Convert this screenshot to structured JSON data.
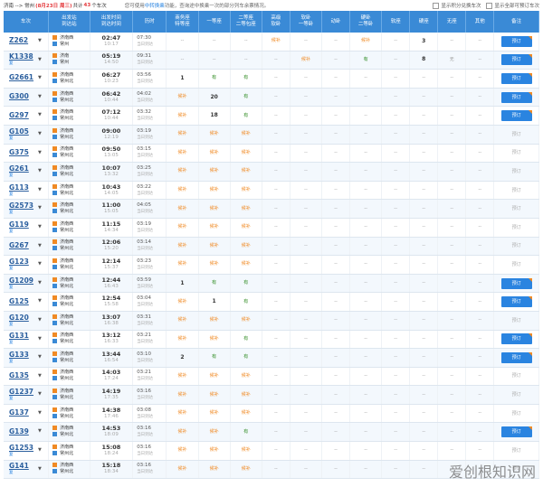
{
  "header": {
    "route": "济南 --> 常州",
    "date": "(8月23日 周三)",
    "count_prefix": "共计",
    "count": "43",
    "count_suffix": "个车次",
    "notice_pre": "您可使用",
    "notice_hl": "中转换乘",
    "notice_post": "功能，查询途中换乘一次的部分列车余票情况。",
    "opt1": "显示积分兑换车次",
    "opt2": "显示全部可预订车次"
  },
  "columns": [
    "车次",
    "出发站\n到达站",
    "出发时间\n到达时间",
    "历时",
    "商务座\n特等座",
    "一等座",
    "二等座\n二等包座",
    "高级\n软卧",
    "软卧\n一等卧",
    "动卧",
    "硬卧\n二等卧",
    "软座",
    "硬座",
    "无座",
    "其他",
    "备注"
  ],
  "rows": [
    {
      "train": "Z262",
      "sub": "",
      "from": "济南西",
      "to": "常州",
      "dep": "02:47",
      "arr": "10:17",
      "dur": "07:30",
      "day": "当日到达",
      "c": [
        "--",
        "--",
        "--",
        "候补",
        "--",
        "--",
        "候补",
        "--",
        "3",
        "--",
        "--"
      ],
      "btn": "预订",
      "bookable": true,
      "from_icon": "s"
    },
    {
      "train": "K1338",
      "sub": "复",
      "from": "济南",
      "to": "常州",
      "dep": "05:19",
      "arr": "14:50",
      "dur": "09:31",
      "day": "当日到达",
      "c": [
        "--",
        "--",
        "--",
        "--",
        "候补",
        "--",
        "有",
        "--",
        "8",
        "无",
        "--"
      ],
      "btn": "预订",
      "bookable": true,
      "from_icon": "s"
    },
    {
      "train": "G2661",
      "sub": "",
      "from": "济南西",
      "to": "常州北",
      "dep": "06:27",
      "arr": "10:23",
      "dur": "03:56",
      "day": "当日到达",
      "c": [
        "1",
        "有",
        "有",
        "--",
        "--",
        "--",
        "--",
        "--",
        "--",
        "--",
        "--"
      ],
      "btn": "预订",
      "bookable": true,
      "from_icon": "s"
    },
    {
      "train": "G300",
      "sub": "",
      "from": "济南西",
      "to": "常州北",
      "dep": "06:42",
      "arr": "10:44",
      "dur": "04:02",
      "day": "当日到达",
      "c": [
        "候补",
        "20",
        "有",
        "--",
        "--",
        "--",
        "--",
        "--",
        "--",
        "--",
        "--"
      ],
      "btn": "预订",
      "bookable": true,
      "from_icon": "s"
    },
    {
      "train": "G297",
      "sub": "",
      "from": "济南西",
      "to": "常州北",
      "dep": "07:12",
      "arr": "10:44",
      "dur": "03:32",
      "day": "当日到达",
      "c": [
        "候补",
        "18",
        "有",
        "--",
        "--",
        "--",
        "--",
        "--",
        "--",
        "--",
        "--"
      ],
      "btn": "预订",
      "bookable": true,
      "from_icon": "s"
    },
    {
      "train": "G105",
      "sub": "复",
      "from": "济南西",
      "to": "常州北",
      "dep": "09:00",
      "arr": "12:19",
      "dur": "03:19",
      "day": "当日到达",
      "c": [
        "候补",
        "候补",
        "候补",
        "--",
        "--",
        "--",
        "--",
        "--",
        "--",
        "--",
        "--"
      ],
      "btn": "预订",
      "bookable": false,
      "from_icon": "s"
    },
    {
      "train": "G375",
      "sub": "",
      "from": "济南西",
      "to": "常州北",
      "dep": "09:50",
      "arr": "13:05",
      "dur": "03:15",
      "day": "当日到达",
      "c": [
        "候补",
        "候补",
        "候补",
        "--",
        "--",
        "--",
        "--",
        "--",
        "--",
        "--",
        "--"
      ],
      "btn": "预订",
      "bookable": false,
      "from_icon": "s"
    },
    {
      "train": "G261",
      "sub": "复",
      "from": "济南西",
      "to": "常州北",
      "dep": "10:07",
      "arr": "13:32",
      "dur": "03:25",
      "day": "当日到达",
      "c": [
        "候补",
        "候补",
        "候补",
        "--",
        "--",
        "--",
        "--",
        "--",
        "--",
        "--",
        "--"
      ],
      "btn": "预订",
      "bookable": false,
      "from_icon": "s"
    },
    {
      "train": "G113",
      "sub": "复",
      "from": "济南西",
      "to": "常州北",
      "dep": "10:43",
      "arr": "14:05",
      "dur": "03:22",
      "day": "当日到达",
      "c": [
        "候补",
        "候补",
        "候补",
        "--",
        "--",
        "--",
        "--",
        "--",
        "--",
        "--",
        "--"
      ],
      "btn": "预订",
      "bookable": false,
      "from_icon": "s"
    },
    {
      "train": "G2573",
      "sub": "复",
      "from": "济南西",
      "to": "常州北",
      "dep": "11:00",
      "arr": "15:05",
      "dur": "04:05",
      "day": "当日到达",
      "c": [
        "候补",
        "候补",
        "候补",
        "--",
        "--",
        "--",
        "--",
        "--",
        "--",
        "--",
        "--"
      ],
      "btn": "预订",
      "bookable": false,
      "from_icon": "s"
    },
    {
      "train": "G119",
      "sub": "复",
      "from": "济南西",
      "to": "常州北",
      "dep": "11:15",
      "arr": "14:34",
      "dur": "03:19",
      "day": "当日到达",
      "c": [
        "候补",
        "候补",
        "候补",
        "--",
        "--",
        "--",
        "--",
        "--",
        "--",
        "--",
        "--"
      ],
      "btn": "预订",
      "bookable": false,
      "from_icon": "s"
    },
    {
      "train": "G267",
      "sub": "",
      "from": "济南西",
      "to": "常州北",
      "dep": "12:06",
      "arr": "15:20",
      "dur": "03:14",
      "day": "当日到达",
      "c": [
        "候补",
        "候补",
        "候补",
        "--",
        "--",
        "--",
        "--",
        "--",
        "--",
        "--",
        "--"
      ],
      "btn": "预订",
      "bookable": false,
      "from_icon": "s"
    },
    {
      "train": "G123",
      "sub": "复",
      "from": "济南西",
      "to": "常州北",
      "dep": "12:14",
      "arr": "15:37",
      "dur": "03:23",
      "day": "当日到达",
      "c": [
        "候补",
        "候补",
        "候补",
        "--",
        "--",
        "--",
        "--",
        "--",
        "--",
        "--",
        "--"
      ],
      "btn": "预订",
      "bookable": false,
      "from_icon": "s"
    },
    {
      "train": "G1209",
      "sub": "复",
      "from": "济南西",
      "to": "常州北",
      "dep": "12:44",
      "arr": "16:43",
      "dur": "03:59",
      "day": "当日到达",
      "c": [
        "1",
        "有",
        "有",
        "--",
        "--",
        "--",
        "--",
        "--",
        "--",
        "--",
        "--"
      ],
      "btn": "预订",
      "bookable": true,
      "from_icon": "s"
    },
    {
      "train": "G125",
      "sub": "",
      "from": "济南西",
      "to": "常州北",
      "dep": "12:54",
      "arr": "15:58",
      "dur": "03:04",
      "day": "当日到达",
      "c": [
        "候补",
        "1",
        "有",
        "--",
        "--",
        "--",
        "--",
        "--",
        "--",
        "--",
        "--"
      ],
      "btn": "预订",
      "bookable": true,
      "from_icon": "s"
    },
    {
      "train": "G120",
      "sub": "复",
      "from": "济南西",
      "to": "常州北",
      "dep": "13:07",
      "arr": "16:38",
      "dur": "03:31",
      "day": "当日到达",
      "c": [
        "候补",
        "候补",
        "候补",
        "--",
        "--",
        "--",
        "--",
        "--",
        "--",
        "--",
        "--"
      ],
      "btn": "预订",
      "bookable": false,
      "from_icon": "s"
    },
    {
      "train": "G131",
      "sub": "复",
      "from": "济南西",
      "to": "常州北",
      "dep": "13:12",
      "arr": "16:33",
      "dur": "03:21",
      "day": "当日到达",
      "c": [
        "候补",
        "候补",
        "有",
        "--",
        "--",
        "--",
        "--",
        "--",
        "--",
        "--",
        "--"
      ],
      "btn": "预订",
      "bookable": true,
      "from_icon": "s"
    },
    {
      "train": "G133",
      "sub": "复",
      "from": "济南西",
      "to": "常州北",
      "dep": "13:44",
      "arr": "16:54",
      "dur": "03:10",
      "day": "当日到达",
      "c": [
        "2",
        "有",
        "有",
        "--",
        "--",
        "--",
        "--",
        "--",
        "--",
        "--",
        "--"
      ],
      "btn": "预订",
      "bookable": true,
      "from_icon": "s"
    },
    {
      "train": "G135",
      "sub": "",
      "from": "济南西",
      "to": "常州北",
      "dep": "14:03",
      "arr": "17:24",
      "dur": "03:21",
      "day": "当日到达",
      "c": [
        "候补",
        "候补",
        "候补",
        "--",
        "--",
        "--",
        "--",
        "--",
        "--",
        "--",
        "--"
      ],
      "btn": "预订",
      "bookable": false,
      "from_icon": "s"
    },
    {
      "train": "G1237",
      "sub": "复",
      "from": "济南西",
      "to": "常州北",
      "dep": "14:19",
      "arr": "17:35",
      "dur": "03:16",
      "day": "当日到达",
      "c": [
        "候补",
        "候补",
        "候补",
        "--",
        "--",
        "--",
        "--",
        "--",
        "--",
        "--",
        "--"
      ],
      "btn": "预订",
      "bookable": false,
      "from_icon": "s"
    },
    {
      "train": "G137",
      "sub": "",
      "from": "济南西",
      "to": "常州北",
      "dep": "14:38",
      "arr": "17:46",
      "dur": "03:08",
      "day": "当日到达",
      "c": [
        "候补",
        "候补",
        "候补",
        "--",
        "--",
        "--",
        "--",
        "--",
        "--",
        "--",
        "--"
      ],
      "btn": "预订",
      "bookable": false,
      "from_icon": "s"
    },
    {
      "train": "G139",
      "sub": "",
      "from": "济南西",
      "to": "常州北",
      "dep": "14:53",
      "arr": "18:09",
      "dur": "03:16",
      "day": "当日到达",
      "c": [
        "候补",
        "候补",
        "有",
        "--",
        "--",
        "--",
        "--",
        "--",
        "--",
        "--",
        "--"
      ],
      "btn": "预订",
      "bookable": true,
      "from_icon": "s"
    },
    {
      "train": "G1253",
      "sub": "复",
      "from": "济南西",
      "to": "常州北",
      "dep": "15:08",
      "arr": "18:24",
      "dur": "03:16",
      "day": "当日到达",
      "c": [
        "候补",
        "候补",
        "候补",
        "--",
        "--",
        "--",
        "--",
        "--",
        "--",
        "--",
        "--"
      ],
      "btn": "预订",
      "bookable": false,
      "from_icon": "s"
    },
    {
      "train": "G141",
      "sub": "复",
      "from": "济南西",
      "to": "常州北",
      "dep": "15:18",
      "arr": "18:34",
      "dur": "03:16",
      "day": "当日到达",
      "c": [
        "候补",
        "候补",
        "候补",
        "--",
        "--",
        "--",
        "--",
        "--",
        "--",
        "--",
        "--"
      ],
      "btn": "预订",
      "bookable": false,
      "from_icon": "s"
    }
  ],
  "watermark": "爱创根知识网",
  "colors": {
    "header_bg": "#3a8ad6",
    "accent": "#2a84e0",
    "houbu": "#f08a24",
    "you": "#2d8a1f"
  }
}
